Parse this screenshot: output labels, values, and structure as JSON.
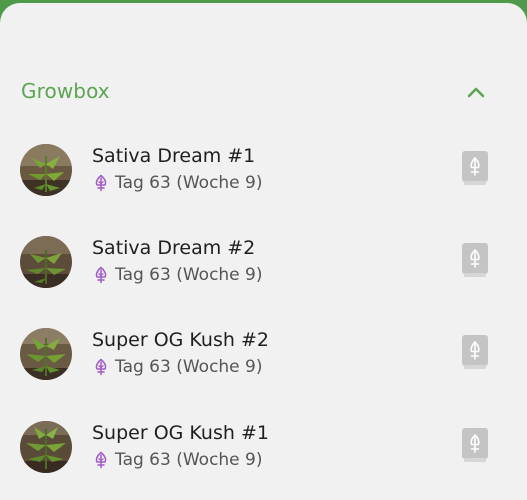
{
  "colors": {
    "accent_green": "#5ca552",
    "top_bar_green": "#4f9a4a",
    "plant_icon_purple": "#a25bc8",
    "diary_icon_gray": "#c4c4c4"
  },
  "section": {
    "title": "Growbox",
    "toggle_icon": "chevron-up-icon"
  },
  "plants": [
    {
      "name": "Sativa Dream #1",
      "day": "Tag 63 (Woche 9)",
      "status_icon": "cannabis-leaf-icon",
      "action_icon": "diary-book-icon"
    },
    {
      "name": "Sativa Dream #2",
      "day": "Tag 63 (Woche 9)",
      "status_icon": "cannabis-leaf-icon",
      "action_icon": "diary-book-icon"
    },
    {
      "name": "Super OG Kush #2",
      "day": "Tag 63 (Woche 9)",
      "status_icon": "cannabis-leaf-icon",
      "action_icon": "diary-book-icon"
    },
    {
      "name": "Super OG Kush #1",
      "day": "Tag 63 (Woche 9)",
      "status_icon": "cannabis-leaf-icon",
      "action_icon": "diary-book-icon"
    }
  ]
}
